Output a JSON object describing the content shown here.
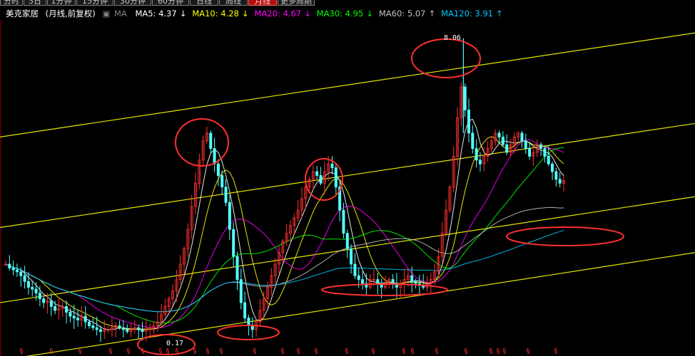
{
  "tabs": [
    {
      "label": "分时",
      "active": false
    },
    {
      "label": "5日",
      "active": false
    },
    {
      "label": "1分钟",
      "active": false
    },
    {
      "label": "15分钟",
      "active": false
    },
    {
      "label": "30分钟",
      "active": false
    },
    {
      "label": "60分钟",
      "active": false
    },
    {
      "label": "日线",
      "active": false
    },
    {
      "label": "周线",
      "active": false
    },
    {
      "label": "月线",
      "active": true
    },
    {
      "label": "更多周期",
      "active": false
    }
  ],
  "legend": {
    "stock_name": "美克家居",
    "period": "(月线,前复权)",
    "ma_label": "MA",
    "items": [
      {
        "label": "MA5: 4.37",
        "arrow": "↓",
        "color": "#ffffff",
        "arrow_color": "#ffffff"
      },
      {
        "label": "MA10: 4.28",
        "arrow": "↓",
        "color": "#ffff00",
        "arrow_color": "#ffff00"
      },
      {
        "label": "MA20: 4.67",
        "arrow": "↓",
        "color": "#ff00ff",
        "arrow_color": "#ff00ff"
      },
      {
        "label": "MA30: 4.95",
        "arrow": "↓",
        "color": "#00ff00",
        "arrow_color": "#00ff00"
      },
      {
        "label": "MA60: 5.07",
        "arrow": "↑",
        "color": "#c0c0c0",
        "arrow_color": "#c0c0c0"
      },
      {
        "label": "MA120: 3.91",
        "arrow": "↑",
        "color": "#00c8ff",
        "arrow_color": "#00c8ff"
      }
    ]
  },
  "annotations": {
    "high_label": "8.06",
    "low_label": "0.17"
  },
  "colors": {
    "up": "#ff3030",
    "down": "#54ffff",
    "channel": "#e6e600",
    "circle": "#ff3030",
    "marker": "#ff3030",
    "axis": "#8b0000"
  },
  "chart_data": {
    "type": "candlestick",
    "title": "美克家居 (月线,前复权)",
    "period": "monthly",
    "ylim": [
      0,
      8.5
    ],
    "highest": 8.06,
    "lowest_label": 0.17,
    "moving_averages": [
      {
        "name": "MA5",
        "value": 4.37,
        "direction": "down",
        "color": "#ffffff"
      },
      {
        "name": "MA10",
        "value": 4.28,
        "direction": "down",
        "color": "#ffff00"
      },
      {
        "name": "MA20",
        "value": 4.67,
        "direction": "down",
        "color": "#ff00ff"
      },
      {
        "name": "MA30",
        "value": 4.95,
        "direction": "down",
        "color": "#00ff00"
      },
      {
        "name": "MA60",
        "value": 5.07,
        "direction": "up",
        "color": "#c0c0c0"
      },
      {
        "name": "MA120",
        "value": 3.91,
        "direction": "up",
        "color": "#00c8ff"
      }
    ],
    "closes": [
      2.2,
      2.1,
      2.05,
      2.0,
      1.9,
      1.75,
      1.6,
      1.55,
      1.45,
      1.3,
      1.2,
      1.25,
      1.1,
      1.0,
      1.05,
      1.1,
      0.95,
      0.85,
      0.8,
      0.75,
      0.85,
      0.7,
      0.6,
      0.55,
      0.5,
      0.45,
      0.5,
      0.5,
      0.55,
      0.6,
      0.55,
      0.5,
      0.45,
      0.5,
      0.55,
      0.5,
      0.45,
      0.5,
      0.55,
      0.6,
      0.7,
      0.9,
      1.1,
      1.3,
      1.5,
      1.8,
      2.2,
      2.6,
      3.1,
      3.7,
      4.3,
      4.9,
      5.4,
      5.6,
      5.2,
      4.8,
      4.5,
      4.2,
      3.8,
      3.1,
      2.4,
      1.8,
      1.2,
      0.8,
      0.6,
      0.5,
      0.7,
      1.0,
      1.3,
      1.6,
      1.9,
      2.2,
      2.5,
      2.8,
      3.0,
      3.2,
      3.4,
      3.6,
      3.9,
      4.2,
      4.4,
      4.6,
      4.5,
      4.3,
      4.6,
      4.8,
      4.7,
      4.2,
      3.6,
      3.0,
      2.6,
      2.2,
      1.9,
      1.8,
      1.7,
      1.6,
      1.8,
      1.8,
      1.7,
      1.6,
      1.7,
      1.8,
      1.7,
      1.6,
      1.7,
      1.8,
      1.9,
      1.75,
      1.7,
      1.65,
      1.6,
      1.7,
      1.8,
      2.0,
      2.4,
      3.0,
      3.6,
      4.2,
      5.0,
      6.0,
      6.8,
      6.2,
      5.6,
      5.2,
      4.9,
      4.8,
      5.0,
      5.2,
      5.4,
      5.6,
      5.5,
      5.3,
      5.1,
      5.3,
      5.5,
      5.6,
      5.4,
      5.2,
      5.0,
      5.1,
      5.3,
      5.2,
      5.0,
      4.8,
      4.6,
      4.4,
      4.3,
      4.37
    ],
    "channel_lines": [
      {
        "name": "channel-1",
        "from": [
          0,
          5.5
        ],
        "to": [
          1,
          8.2
        ]
      },
      {
        "name": "channel-2",
        "from": [
          0,
          3.15
        ],
        "to": [
          1,
          5.85
        ]
      },
      {
        "name": "channel-3",
        "from": [
          0,
          1.2
        ],
        "to": [
          1,
          3.95
        ]
      },
      {
        "name": "channel-4",
        "from": [
          0,
          -0.3
        ],
        "to": [
          1,
          2.5
        ]
      }
    ],
    "marked_regions": [
      "peak-1",
      "peak-2",
      "peak-3",
      "bottom-1",
      "bottom-2",
      "bottom-3",
      "bottom-4"
    ],
    "grid": false
  }
}
